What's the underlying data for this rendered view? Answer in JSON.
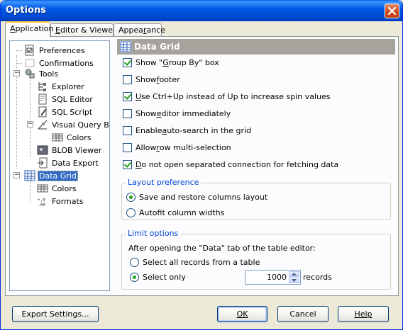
{
  "window": {
    "title": "Options"
  },
  "tabs": [
    {
      "label": "Application",
      "mnemonic": "A",
      "rest": "pplication"
    },
    {
      "label": "Editor & Viewers",
      "pre": "",
      "mnemonic": "E",
      "rest": "ditor & Viewers"
    },
    {
      "label": "Appearance",
      "pre": "Appea",
      "mnemonic": "r",
      "rest": "ance"
    }
  ],
  "tree": [
    {
      "label": "Preferences",
      "icon": "preferences-icon"
    },
    {
      "label": "Confirmations",
      "icon": "confirmations-icon"
    },
    {
      "label": "Tools",
      "icon": "tools-icon"
    },
    {
      "label": "Explorer",
      "icon": "explorer-icon"
    },
    {
      "label": "SQL Editor",
      "icon": "sql-editor-icon"
    },
    {
      "label": "SQL Script",
      "icon": "sql-script-icon"
    },
    {
      "label": "Visual Query Build",
      "icon": "visual-query-builder-icon"
    },
    {
      "label": "Colors",
      "icon": "colors-icon"
    },
    {
      "label": "BLOB Viewer",
      "icon": "blob-viewer-icon"
    },
    {
      "label": "Data Export",
      "icon": "data-export-icon"
    },
    {
      "label": "Data Grid",
      "icon": "data-grid-icon",
      "selected": true
    },
    {
      "label": "Colors",
      "icon": "colors-icon"
    },
    {
      "label": "Formats",
      "icon": "formats-icon"
    }
  ],
  "section": {
    "title": "Data Grid",
    "icon": "data-grid-icon"
  },
  "checkboxes": [
    {
      "pre": "Show \"",
      "ul": "G",
      "post": "roup By\" box",
      "checked": true
    },
    {
      "pre": "Show ",
      "ul": "f",
      "post": "ooter",
      "checked": false
    },
    {
      "pre": "",
      "ul": "U",
      "post": "se Ctrl+Up instead of Up to increase spin values",
      "checked": true
    },
    {
      "pre": "Show ",
      "ul": "e",
      "post": "ditor immediately",
      "checked": false
    },
    {
      "pre": "Enable ",
      "ul": "a",
      "post": "uto-search in the grid",
      "checked": false
    },
    {
      "pre": "Allow ",
      "ul": "r",
      "post": "ow multi-selection",
      "checked": false
    },
    {
      "pre": "",
      "ul": "D",
      "post": "o not open separated connection for fetching data",
      "checked": true
    }
  ],
  "layout_preference": {
    "title": "Layout preference",
    "options": [
      {
        "label": "Save and restore columns layout",
        "checked": true
      },
      {
        "label": "Autofit column widths",
        "checked": false
      }
    ]
  },
  "limit_options": {
    "title": "Limit options",
    "description": "After opening the \"Data\" tab of the table editor:",
    "options": [
      {
        "label": "Select all records from a table",
        "checked": false
      },
      {
        "label": "Select only",
        "checked": true
      }
    ],
    "count": "1000",
    "unit": "records"
  },
  "buttons": {
    "export": "Export Settings...",
    "ok": "OK",
    "cancel": "Cancel",
    "help": "Help"
  },
  "colors": {
    "titlebar": "#0058e6",
    "selection": "#316ac5",
    "group_title": "#0046d5",
    "check": "#21a121"
  }
}
